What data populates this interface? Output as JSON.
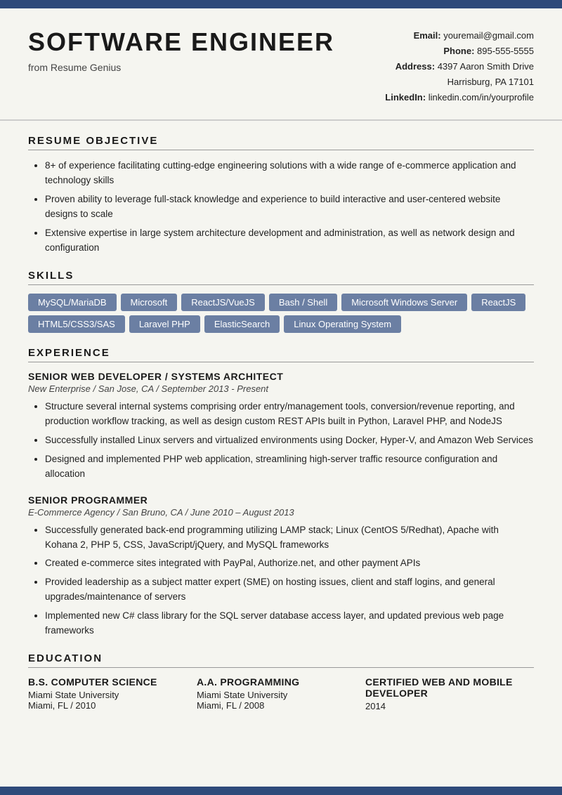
{
  "topBar": {},
  "header": {
    "title": "SOFTWARE ENGINEER",
    "subtitle": "from Resume Genius",
    "contact": {
      "emailLabel": "Email:",
      "email": "youremail@gmail.com",
      "phoneLabel": "Phone:",
      "phone": "895-555-5555",
      "addressLabel": "Address:",
      "addressLine1": "4397 Aaron Smith Drive",
      "addressLine2": "Harrisburg, PA 17101",
      "linkedinLabel": "LinkedIn:",
      "linkedin": "linkedin.com/in/yourprofile"
    }
  },
  "sections": {
    "objective": {
      "title": "RESUME OBJECTIVE",
      "bullets": [
        "8+ of experience facilitating cutting-edge engineering solutions with a wide range of e-commerce application and technology skills",
        "Proven ability to leverage full-stack knowledge and experience to build interactive and user-centered website designs to scale",
        "Extensive expertise in large system architecture development and administration, as well as network design and configuration"
      ]
    },
    "skills": {
      "title": "SKILLS",
      "items": [
        "MySQL/MariaDB",
        "Microsoft",
        "ReactJS/VueJS",
        "Bash / Shell",
        "Microsoft Windows Server",
        "ReactJS",
        "HTML5/CSS3/SAS",
        "Laravel PHP",
        "ElasticSearch",
        "Linux Operating System"
      ]
    },
    "experience": {
      "title": "EXPERIENCE",
      "jobs": [
        {
          "title": "SENIOR WEB DEVELOPER / SYSTEMS ARCHITECT",
          "meta": "New Enterprise / San Jose, CA / September 2013 - Present",
          "bullets": [
            "Structure several internal systems comprising order entry/management tools, conversion/revenue reporting, and production workflow tracking, as well as design custom REST APIs built in Python, Laravel PHP, and NodeJS",
            "Successfully installed Linux servers and virtualized environments using Docker, Hyper-V, and Amazon Web Services",
            "Designed and implemented PHP web application, streamlining high-server traffic resource configuration and allocation"
          ]
        },
        {
          "title": "SENIOR PROGRAMMER",
          "meta": "E-Commerce Agency / San Bruno, CA / June 2010 – August 2013",
          "bullets": [
            "Successfully generated back-end programming utilizing LAMP stack; Linux (CentOS 5/Redhat), Apache with Kohana 2, PHP 5, CSS, JavaScript/jQuery, and MySQL frameworks",
            "Created e-commerce sites integrated with PayPal, Authorize.net, and other payment APIs",
            "Provided leadership as a subject matter expert (SME) on hosting issues, client and staff logins, and general upgrades/maintenance of servers",
            "Implemented new C# class library for the SQL server database access layer, and updated previous web page frameworks"
          ]
        }
      ]
    },
    "education": {
      "title": "EDUCATION",
      "items": [
        {
          "degree": "B.S. COMPUTER SCIENCE",
          "school": "Miami State University",
          "detail": "Miami, FL / 2010"
        },
        {
          "degree": "A.A. PROGRAMMING",
          "school": "Miami State University",
          "detail": "Miami, FL / 2008"
        },
        {
          "degree": "CERTIFIED WEB AND MOBILE DEVELOPER",
          "school": "",
          "detail": "2014"
        }
      ]
    }
  }
}
